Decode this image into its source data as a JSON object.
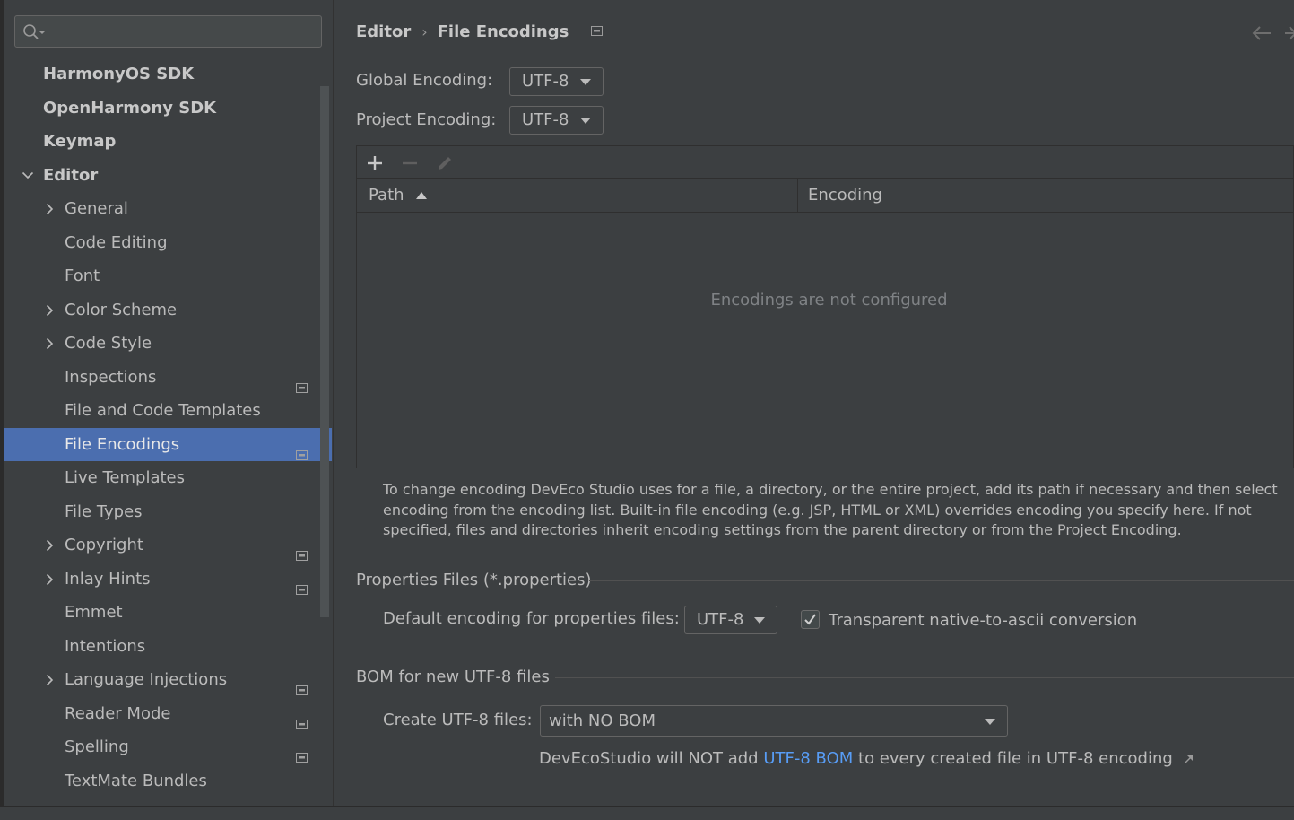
{
  "search": {
    "placeholder": "",
    "value": ""
  },
  "sidebar": {
    "items": [
      {
        "label": "HarmonyOS SDK",
        "bold": true,
        "level": 0
      },
      {
        "label": "OpenHarmony SDK",
        "bold": true,
        "level": 0
      },
      {
        "label": "Keymap",
        "bold": true,
        "level": 0
      },
      {
        "label": "Editor",
        "bold": true,
        "level": 0,
        "expanded": true
      },
      {
        "label": "General",
        "level": 1,
        "collapsed": true
      },
      {
        "label": "Code Editing",
        "level": 1
      },
      {
        "label": "Font",
        "level": 1
      },
      {
        "label": "Color Scheme",
        "level": 1,
        "collapsed": true
      },
      {
        "label": "Code Style",
        "level": 1,
        "collapsed": true
      },
      {
        "label": "Inspections",
        "level": 1,
        "project_icon": true
      },
      {
        "label": "File and Code Templates",
        "level": 1
      },
      {
        "label": "File Encodings",
        "level": 1,
        "project_icon": true,
        "selected": true
      },
      {
        "label": "Live Templates",
        "level": 1
      },
      {
        "label": "File Types",
        "level": 1
      },
      {
        "label": "Copyright",
        "level": 1,
        "collapsed": true,
        "project_icon": true
      },
      {
        "label": "Inlay Hints",
        "level": 1,
        "collapsed": true,
        "project_icon": true
      },
      {
        "label": "Emmet",
        "level": 1
      },
      {
        "label": "Intentions",
        "level": 1
      },
      {
        "label": "Language Injections",
        "level": 1,
        "collapsed": true,
        "project_icon": true
      },
      {
        "label": "Reader Mode",
        "level": 1,
        "project_icon": true
      },
      {
        "label": "Spelling",
        "level": 1,
        "project_icon": true
      },
      {
        "label": "TextMate Bundles",
        "level": 1
      }
    ]
  },
  "breadcrumb": {
    "parent": "Editor",
    "separator": "›",
    "current": "File Encodings"
  },
  "encodings": {
    "global_label": "Global Encoding:",
    "global_value": "UTF-8",
    "project_label": "Project Encoding:",
    "project_value": "UTF-8"
  },
  "table": {
    "columns": [
      "Path",
      "Encoding"
    ],
    "sort_column": "Path",
    "sort_direction": "ascending",
    "empty_text": "Encodings are not configured"
  },
  "hint": "To change encoding DevEco Studio uses for a file, a directory, or the entire project, add its path if necessary and then select encoding from the encoding list. Built-in file encoding (e.g. JSP, HTML or XML) overrides encoding you specify here. If not specified, files and directories inherit encoding settings from the parent directory or from the Project Encoding.",
  "properties": {
    "section_title": "Properties Files (*.properties)",
    "default_label": "Default encoding for properties files:",
    "default_value": "UTF-8",
    "transparent_label": "Transparent native-to-ascii conversion",
    "transparent_checked": true
  },
  "bom": {
    "section_title": "BOM for new UTF-8 files",
    "create_label": "Create UTF-8 files:",
    "create_value": "with NO BOM",
    "note_prefix": "DevEcoStudio will NOT add",
    "note_link": "UTF-8 BOM",
    "note_suffix": "to every created file in UTF-8 encoding"
  },
  "colors": {
    "background": "#3c3f41",
    "selection": "#4b6eaf",
    "link": "#589df6",
    "text": "#bbbbbb",
    "muted_text": "#7f8285"
  }
}
